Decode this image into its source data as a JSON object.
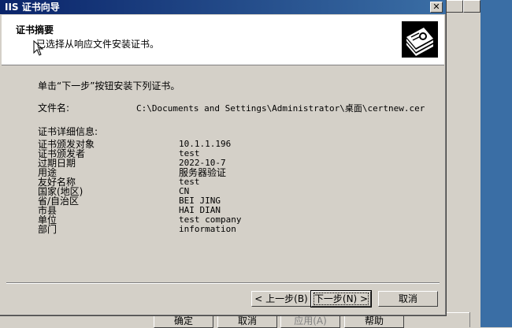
{
  "background_app": {
    "buttons": [
      {
        "label": "确定",
        "disabled": false
      },
      {
        "label": "取消",
        "disabled": false
      },
      {
        "label": "应用(A)",
        "disabled": true
      },
      {
        "label": "帮助",
        "disabled": false
      }
    ]
  },
  "wizard": {
    "title": "IIS 证书向导",
    "close_glyph": "✕",
    "header": {
      "title": "证书摘要",
      "subtitle": "已选择从响应文件安装证书。"
    },
    "intro": "单击“下一步”按钮安装下列证书。",
    "file": {
      "label": "文件名:",
      "value": "C:\\Documents and Settings\\Administrator\\桌面\\certnew.cer"
    },
    "details_title": "证书详细信息:",
    "details": [
      {
        "label": "证书颁发对象",
        "value": "10.1.1.196"
      },
      {
        "label": "证书颁发者",
        "value": "test"
      },
      {
        "label": "过期日期",
        "value": "2022-10-7"
      },
      {
        "label": "用途",
        "value": "服务器验证"
      },
      {
        "label": "友好名称",
        "value": "test"
      },
      {
        "label": "国家(地区)",
        "value": "CN"
      },
      {
        "label": "省/自治区",
        "value": "BEI JING"
      },
      {
        "label": "市县",
        "value": "HAI DIAN"
      },
      {
        "label": "单位",
        "value": "test company"
      },
      {
        "label": "部门",
        "value": "information"
      }
    ],
    "buttons": {
      "back": "< 上一步(B)",
      "next": "下一步(N) >",
      "cancel": "取消"
    }
  }
}
